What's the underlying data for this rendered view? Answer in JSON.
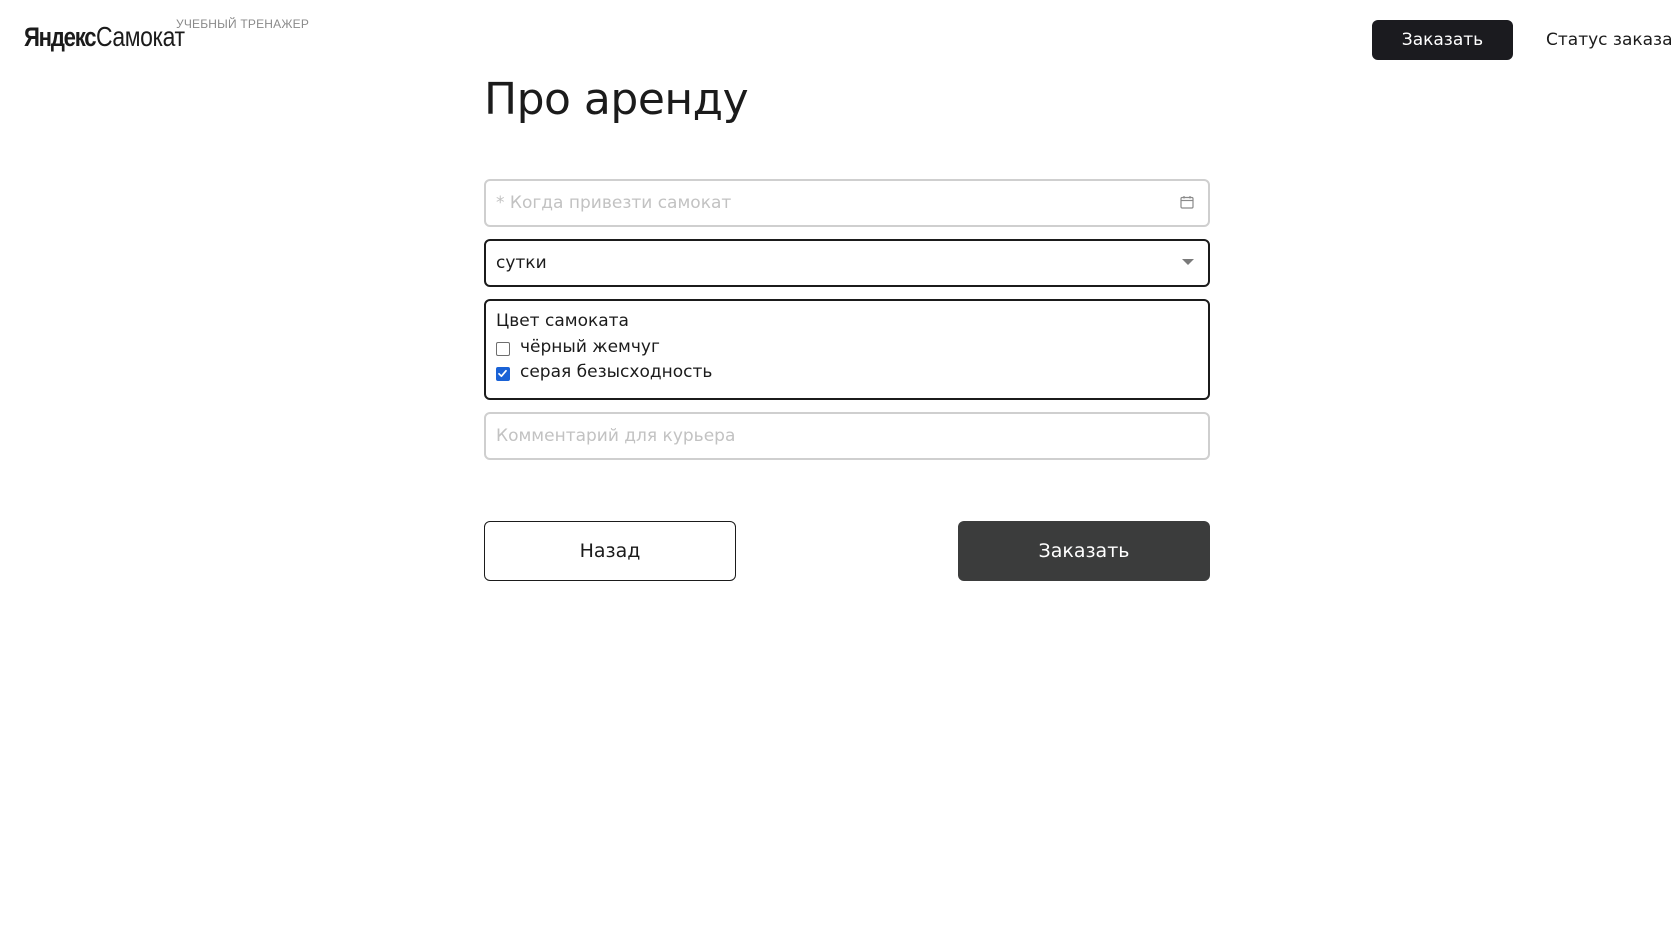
{
  "header": {
    "logo_yandex": "Яндекс",
    "logo_samokat": "Самокат",
    "logo_subtitle": "УЧЕБНЫЙ ТРЕНАЖЕР",
    "order_button_label": "Заказать",
    "status_link_label": "Статус заказа"
  },
  "page": {
    "title": "Про аренду"
  },
  "form": {
    "date_field": {
      "placeholder": "* Когда привезти самокат",
      "value": "",
      "icon": "calendar-icon"
    },
    "rental_period": {
      "selected_value": "сутки",
      "icon": "chevron-down-icon"
    },
    "colors": {
      "title": "Цвет самоката",
      "options": [
        {
          "label": "чёрный жемчуг",
          "checked": false
        },
        {
          "label": "серая безысходность",
          "checked": true
        }
      ]
    },
    "comment_field": {
      "placeholder": "Комментарий для курьера",
      "value": ""
    }
  },
  "actions": {
    "back_label": "Назад",
    "order_label": "Заказать"
  },
  "colors": {
    "primary_dark": "#1b1b1f",
    "order_button": "#3b3c3c",
    "checkbox_checked": "#1a62d6",
    "field_border_inactive": "#cfcfcf",
    "field_border_active": "#1b1b1b"
  }
}
